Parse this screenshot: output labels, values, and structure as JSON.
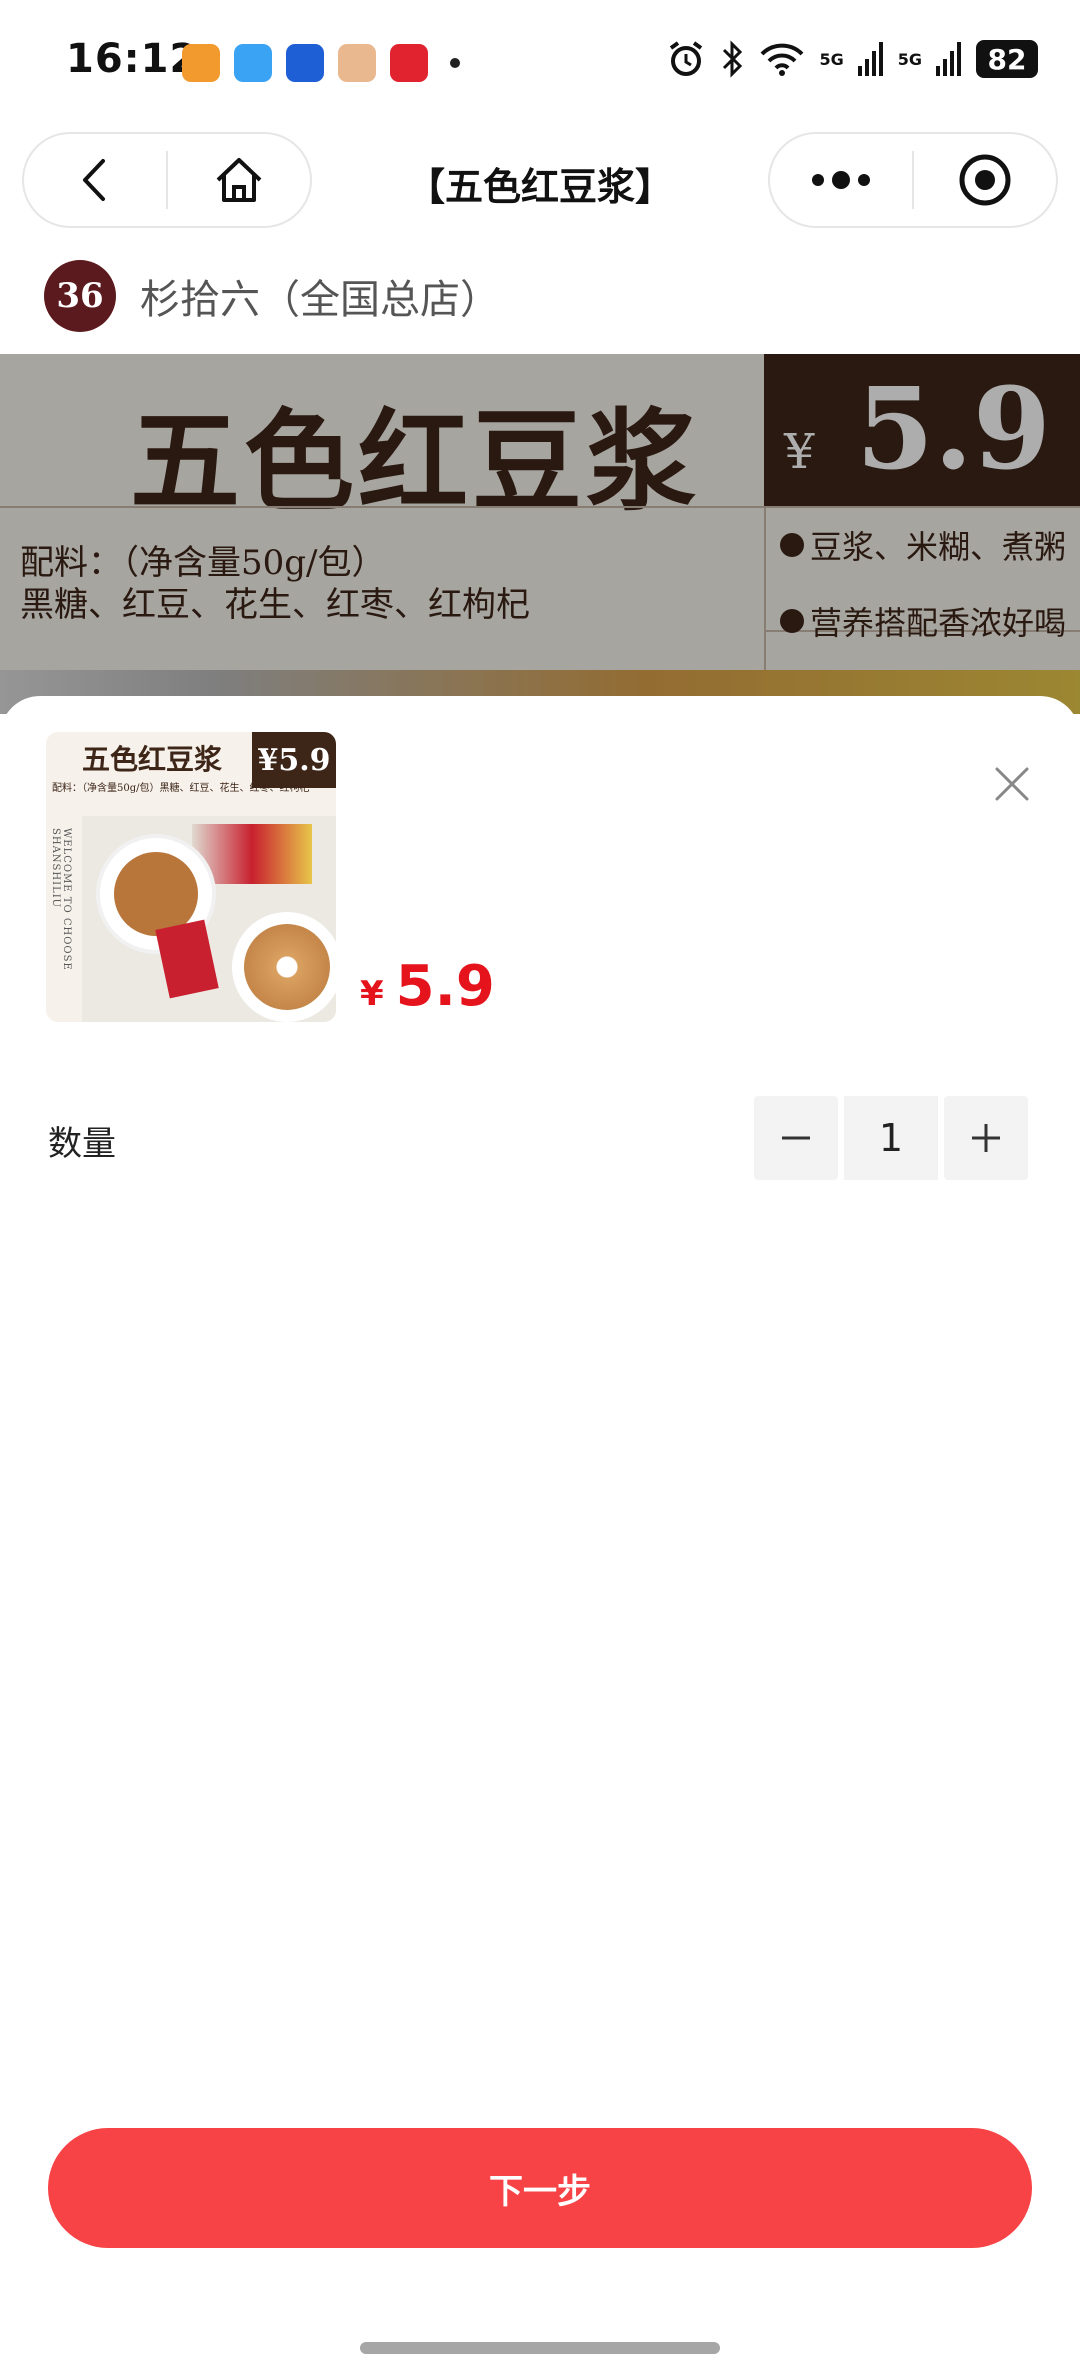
{
  "status_bar": {
    "time": "16:12",
    "battery": "82",
    "signal_1": "5G",
    "signal_2": "5G",
    "app_icon_names": [
      "app-1-icon",
      "app-2-icon",
      "app-3-icon",
      "app-4-icon",
      "app-5-icon"
    ]
  },
  "nav": {
    "title": "【五色红豆浆】",
    "back_icon": "chevron-left-icon",
    "home_icon": "home-icon",
    "more_icon": "more-dots-icon",
    "target_icon": "target-icon"
  },
  "store": {
    "logo_text": "36",
    "name": "杉拾六（全国总店）"
  },
  "banner": {
    "title": "五色红豆浆",
    "yen": "¥",
    "price": "5.9",
    "ingredients_line1": "配料：（净含量50g/包）",
    "ingredients_line2": "黑糖、红豆、花生、红枣、红枸杞",
    "feature_1": "豆浆、米糊、煮粥",
    "feature_2": "营养搭配香浓好喝"
  },
  "sheet": {
    "thumb": {
      "title": "五色红豆浆",
      "price": "¥5.9",
      "ingredients": "配料：（净含量50g/包）黑糖、红豆、花生、红枣、红枸杞",
      "side_text": "WELCOME TO CHOOSE SHANSHILIU"
    },
    "price_yen": "¥",
    "price_value": "5.9",
    "quantity_label": "数量",
    "quantity_value": "1",
    "next_button": "下一步"
  },
  "colors": {
    "accent_red": "#e4131c",
    "button_red": "#f74346",
    "brand_brown": "#3d2518"
  }
}
